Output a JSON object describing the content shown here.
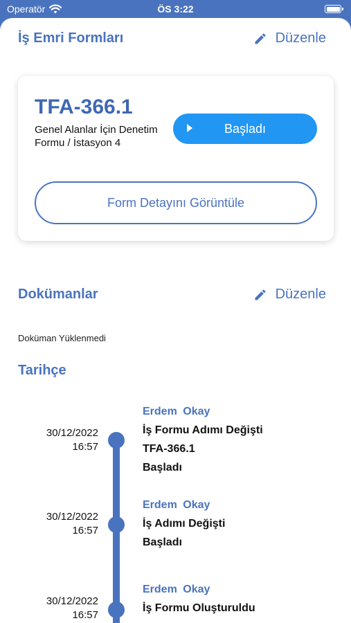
{
  "status_bar": {
    "carrier": "Operatör",
    "time": "ÖS 3:22"
  },
  "header": {
    "title": "İş Emri Formları",
    "edit_label": "Düzenle"
  },
  "form_card": {
    "code": "TFA-366.1",
    "description": "Genel Alanlar İçin Denetim Formu / İstasyon 4",
    "status_label": "Başladı",
    "view_button_label": "Form Detayını Görüntüle"
  },
  "documents": {
    "title": "Dokümanlar",
    "edit_label": "Düzenle",
    "empty_text": "Doküman Yüklenmedi"
  },
  "history": {
    "title": "Tarihçe",
    "entries": [
      {
        "user": "Erdem Okay",
        "date": "30/12/2022",
        "time": "16:57",
        "lines": [
          "İş Formu Adımı Değişti",
          "TFA-366.1",
          "Başladı"
        ]
      },
      {
        "user": "Erdem Okay",
        "date": "30/12/2022",
        "time": "16:57",
        "lines": [
          "İş Adımı Değişti",
          "Başladı"
        ]
      },
      {
        "user": "Erdem Okay",
        "date": "30/12/2022",
        "time": "16:57",
        "lines": [
          "İş Formu Oluşturuldu"
        ]
      }
    ]
  },
  "colors": {
    "accent": "#4a73bf",
    "button_blue": "#2196f3",
    "background": "#ffffff"
  },
  "icons": [
    "wifi-icon",
    "battery-icon",
    "pencil-icon",
    "play-icon"
  ]
}
